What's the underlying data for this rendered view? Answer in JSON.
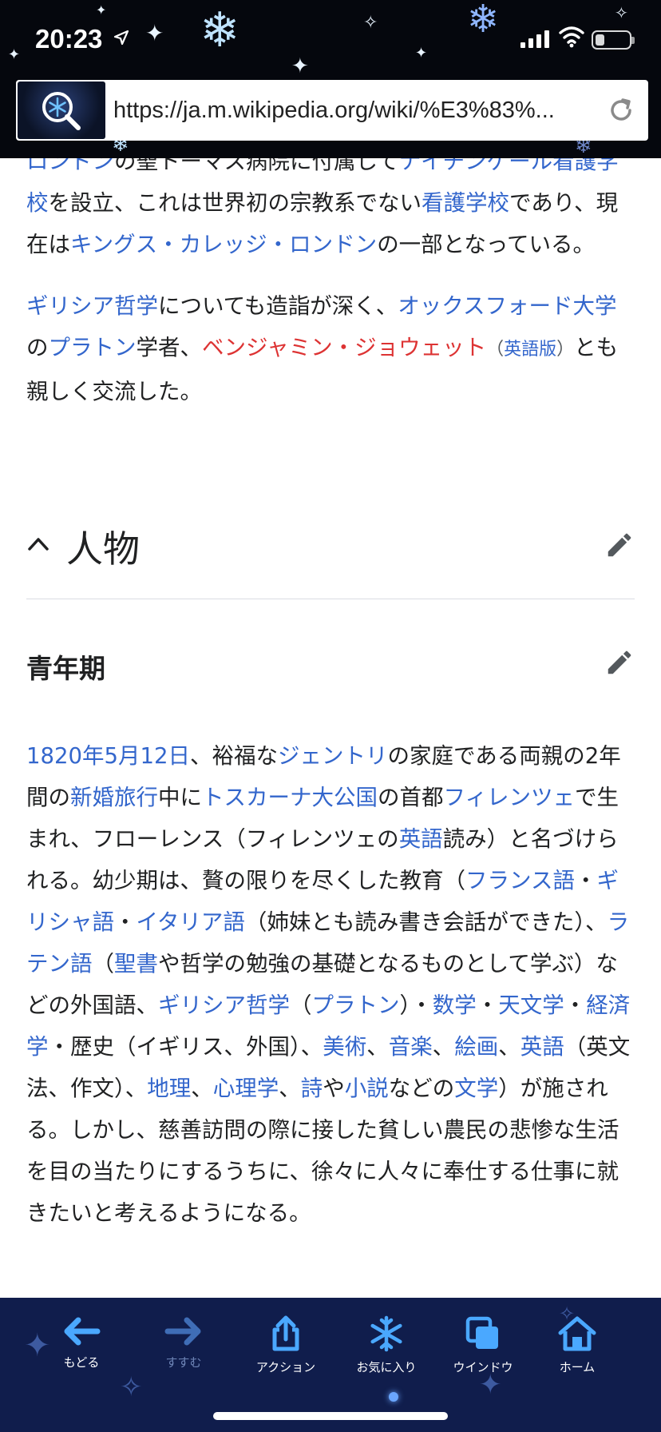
{
  "status": {
    "time": "20:23"
  },
  "browser": {
    "url": "https://ja.m.wikipedia.org/wiki/%E3%83%..."
  },
  "intro": {
    "p1": [
      {
        "t": "ロンドン",
        "link": "wl"
      },
      {
        "t": "の聖トーマス病院に付属して"
      },
      {
        "t": "ナイチンゲール看護学校",
        "link": "wl"
      },
      {
        "t": "を設立、これは世界初の宗教系でない"
      },
      {
        "t": "看護学校",
        "link": "wl"
      },
      {
        "t": "であり、現在は"
      },
      {
        "t": "キングス・カレッジ・ロンドン",
        "link": "wl"
      },
      {
        "t": "の一部となっている。"
      }
    ],
    "p2": [
      {
        "t": "ギリシア哲学",
        "link": "wl"
      },
      {
        "t": "についても造詣が深く、"
      },
      {
        "t": "オックスフォード大学",
        "link": "wl"
      },
      {
        "t": "の"
      },
      {
        "t": "プラトン",
        "link": "wl"
      },
      {
        "t": "学者、"
      },
      {
        "t": "ベンジャミン・ジョウェット",
        "link": "red"
      },
      {
        "t": "（",
        "cls": "small-paren"
      },
      {
        "t": "英語版",
        "link": "small"
      },
      {
        "t": "）",
        "cls": "small-paren"
      },
      {
        "t": "とも親しく交流した。"
      }
    ]
  },
  "section": {
    "title": "人物"
  },
  "subsection": {
    "title": "青年期"
  },
  "body": {
    "p3": [
      {
        "t": "1820年5月12日",
        "link": "wl"
      },
      {
        "t": "、裕福な"
      },
      {
        "t": "ジェントリ",
        "link": "wl"
      },
      {
        "t": "の家庭である両親の2年間の"
      },
      {
        "t": "新婚旅行",
        "link": "wl"
      },
      {
        "t": "中に"
      },
      {
        "t": "トスカーナ大公国",
        "link": "wl"
      },
      {
        "t": "の首都"
      },
      {
        "t": "フィレンツェ",
        "link": "wl"
      },
      {
        "t": "で生まれ、フローレンス（フィレンツェの"
      },
      {
        "t": "英語",
        "link": "wl"
      },
      {
        "t": "読み）と名づけられる。幼少期は、贅の限りを尽くした教育（"
      },
      {
        "t": "フランス語",
        "link": "wl"
      },
      {
        "t": "・"
      },
      {
        "t": "ギリシャ語",
        "link": "wl"
      },
      {
        "t": "・"
      },
      {
        "t": "イタリア語",
        "link": "wl"
      },
      {
        "t": "（姉妹とも読み書き会話ができた）、"
      },
      {
        "t": "ラテン語",
        "link": "wl"
      },
      {
        "t": "（"
      },
      {
        "t": "聖書",
        "link": "wl"
      },
      {
        "t": "や哲学の勉強の基礎となるものとして学ぶ）などの外国語、"
      },
      {
        "t": "ギリシア哲学",
        "link": "wl"
      },
      {
        "t": "（"
      },
      {
        "t": "プラトン",
        "link": "wl"
      },
      {
        "t": "）・"
      },
      {
        "t": "数学",
        "link": "wl"
      },
      {
        "t": "・"
      },
      {
        "t": "天文学",
        "link": "wl"
      },
      {
        "t": "・"
      },
      {
        "t": "経済学",
        "link": "wl"
      },
      {
        "t": "・歴史（イギリス、外国）、"
      },
      {
        "t": "美術",
        "link": "wl"
      },
      {
        "t": "、"
      },
      {
        "t": "音楽",
        "link": "wl"
      },
      {
        "t": "、"
      },
      {
        "t": "絵画",
        "link": "wl"
      },
      {
        "t": "、"
      },
      {
        "t": "英語",
        "link": "wl"
      },
      {
        "t": "（英文法、作文）、"
      },
      {
        "t": "地理",
        "link": "wl"
      },
      {
        "t": "、"
      },
      {
        "t": "心理学",
        "link": "wl"
      },
      {
        "t": "、"
      },
      {
        "t": "詩",
        "link": "wl"
      },
      {
        "t": "や"
      },
      {
        "t": "小説",
        "link": "wl"
      },
      {
        "t": "などの"
      },
      {
        "t": "文学",
        "link": "wl"
      },
      {
        "t": "）が施される。しかし、慈善訪問の際に接した貧しい農民の悲惨な生活を目の当たりにするうちに、徐々に人々に奉仕する仕事に就きたいと考えるようになる。"
      }
    ]
  },
  "toolbar": {
    "back": "もどる",
    "forward": "すすむ",
    "action": "アクション",
    "favorites": "お気に入り",
    "windows": "ウインドウ",
    "home": "ホーム"
  },
  "colors": {
    "link": "#3366cc",
    "redlink": "#dd3333",
    "toolbar_bg": "#101d4c",
    "toolbar_icon": "#4aa8ff"
  },
  "icons": [
    "location-arrow-icon",
    "signal-icon",
    "wifi-icon",
    "battery-icon",
    "snowflake-search-icon",
    "reload-icon",
    "chevron-up-icon",
    "pencil-icon",
    "arrow-left-icon",
    "arrow-right-icon",
    "share-icon",
    "snowflake-icon",
    "windows-icon",
    "home-icon"
  ]
}
